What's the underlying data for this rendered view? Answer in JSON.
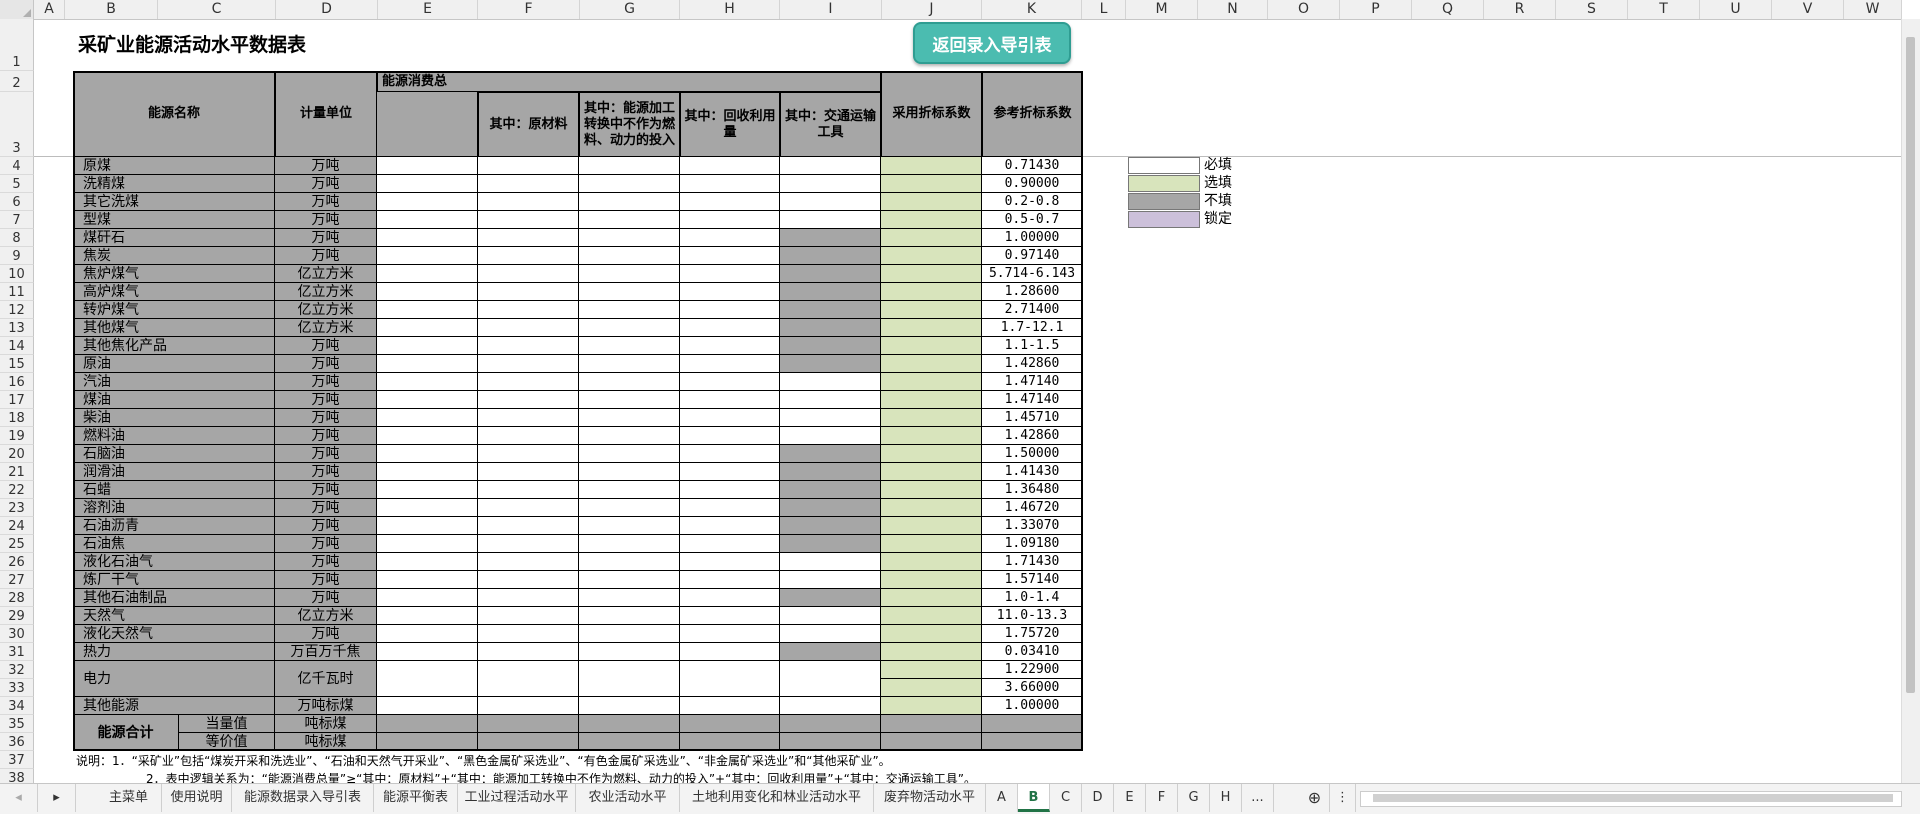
{
  "columns": [
    "A",
    "B",
    "C",
    "D",
    "E",
    "F",
    "G",
    "H",
    "I",
    "J",
    "K",
    "L",
    "M",
    "N",
    "O",
    "P",
    "Q",
    "R",
    "S",
    "T",
    "U",
    "V",
    "W"
  ],
  "title": "采矿业能源活动水平数据表",
  "return_button": "返回录入导引表",
  "headers": {
    "energy_name": "能源名称",
    "unit": "计量单位",
    "total": "能源消费总",
    "raw": "其中：原材料",
    "noncombust": "其中：能源加工转换中不作为燃料、动力的投入",
    "recycled": "其中：回收利用量",
    "transport": "其中：交通运输工具",
    "adopted": "采用折标系数",
    "reference": "参考折标系数"
  },
  "rows": [
    {
      "r": "4",
      "name": "原煤",
      "unit": "万吨",
      "ref": "0.71430",
      "i_gray": false
    },
    {
      "r": "5",
      "name": "洗精煤",
      "unit": "万吨",
      "ref": "0.90000",
      "i_gray": false
    },
    {
      "r": "6",
      "name": "其它洗煤",
      "unit": "万吨",
      "ref": "0.2-0.8",
      "i_gray": false
    },
    {
      "r": "7",
      "name": "型煤",
      "unit": "万吨",
      "ref": "0.5-0.7",
      "i_gray": false
    },
    {
      "r": "8",
      "name": "煤矸石",
      "unit": "万吨",
      "ref": "1.00000",
      "i_gray": true
    },
    {
      "r": "9",
      "name": "焦炭",
      "unit": "万吨",
      "ref": "0.97140",
      "i_gray": true
    },
    {
      "r": "10",
      "name": "焦炉煤气",
      "unit": "亿立方米",
      "ref": "5.714-6.143",
      "i_gray": true
    },
    {
      "r": "11",
      "name": "高炉煤气",
      "unit": "亿立方米",
      "ref": "1.28600",
      "i_gray": true
    },
    {
      "r": "12",
      "name": "转炉煤气",
      "unit": "亿立方米",
      "ref": "2.71400",
      "i_gray": true
    },
    {
      "r": "13",
      "name": "其他煤气",
      "unit": "亿立方米",
      "ref": "1.7-12.1",
      "i_gray": true
    },
    {
      "r": "14",
      "name": "其他焦化产品",
      "unit": "万吨",
      "ref": "1.1-1.5",
      "i_gray": true
    },
    {
      "r": "15",
      "name": "原油",
      "unit": "万吨",
      "ref": "1.42860",
      "i_gray": true
    },
    {
      "r": "16",
      "name": "汽油",
      "unit": "万吨",
      "ref": "1.47140",
      "i_gray": false
    },
    {
      "r": "17",
      "name": "煤油",
      "unit": "万吨",
      "ref": "1.47140",
      "i_gray": false
    },
    {
      "r": "18",
      "name": "柴油",
      "unit": "万吨",
      "ref": "1.45710",
      "i_gray": false
    },
    {
      "r": "19",
      "name": "燃料油",
      "unit": "万吨",
      "ref": "1.42860",
      "i_gray": false
    },
    {
      "r": "20",
      "name": "石脑油",
      "unit": "万吨",
      "ref": "1.50000",
      "i_gray": true
    },
    {
      "r": "21",
      "name": "润滑油",
      "unit": "万吨",
      "ref": "1.41430",
      "i_gray": true
    },
    {
      "r": "22",
      "name": "石蜡",
      "unit": "万吨",
      "ref": "1.36480",
      "i_gray": true
    },
    {
      "r": "23",
      "name": "溶剂油",
      "unit": "万吨",
      "ref": "1.46720",
      "i_gray": true
    },
    {
      "r": "24",
      "name": "石油沥青",
      "unit": "万吨",
      "ref": "1.33070",
      "i_gray": true
    },
    {
      "r": "25",
      "name": "石油焦",
      "unit": "万吨",
      "ref": "1.09180",
      "i_gray": true
    },
    {
      "r": "26",
      "name": "液化石油气",
      "unit": "万吨",
      "ref": "1.71430",
      "i_gray": false
    },
    {
      "r": "27",
      "name": "炼厂干气",
      "unit": "万吨",
      "ref": "1.57140",
      "i_gray": false
    },
    {
      "r": "28",
      "name": "其他石油制品",
      "unit": "万吨",
      "ref": "1.0-1.4",
      "i_gray": true
    },
    {
      "r": "29",
      "name": "天然气",
      "unit": "亿立方米",
      "ref": "11.0-13.3",
      "i_gray": false
    },
    {
      "r": "30",
      "name": "液化天然气",
      "unit": "万吨",
      "ref": "1.75720",
      "i_gray": false
    },
    {
      "r": "31",
      "name": "热力",
      "unit": "万百万千焦",
      "ref": "0.03410",
      "i_gray": true
    }
  ],
  "electricity": {
    "name": "电力",
    "unit": "亿千瓦时",
    "ref1": "1.22900",
    "ref2": "3.66000"
  },
  "other_energy": {
    "name": "其他能源",
    "unit": "万吨标煤",
    "ref": "1.00000"
  },
  "total_block": {
    "label": "能源合计",
    "equiv_label": "当量值",
    "equiv_unit": "吨标煤",
    "price_label": "等价值",
    "price_unit": "吨标煤"
  },
  "legend": [
    {
      "label": "必填",
      "color": "#ffffff"
    },
    {
      "label": "选填",
      "color": "#d8e4bc"
    },
    {
      "label": "不填",
      "color": "#a6a6a6"
    },
    {
      "label": "锁定",
      "color": "#ccc0da"
    }
  ],
  "notes": {
    "n1": "说明：1．“采矿业”包括“煤炭开采和洗选业”、“石油和天然气开采业”、“黑色金属矿采选业”、“有色金属矿采选业”、“非金属矿采选业”和“其他采矿业”。",
    "n2": "2．表中逻辑关系为：“能源消费总量”≥“其中：原材料”+“其中：能源加工转换中不作为燃料、动力的投入”+“其中：回收利用量”+“其中：交通运输工具”。"
  },
  "tabs": [
    "主菜单",
    "使用说明",
    "能源数据录入导引表",
    "能源平衡表",
    "工业过程活动水平",
    "农业活动水平",
    "土地利用变化和林业活动水平",
    "废弃物活动水平",
    "A",
    "B",
    "C",
    "D",
    "E",
    "F",
    "G",
    "H",
    "..."
  ],
  "active_tab": "B",
  "row_labels": [
    "1",
    "2",
    "3",
    "32",
    "33",
    "34",
    "35",
    "36",
    "37",
    "38"
  ]
}
